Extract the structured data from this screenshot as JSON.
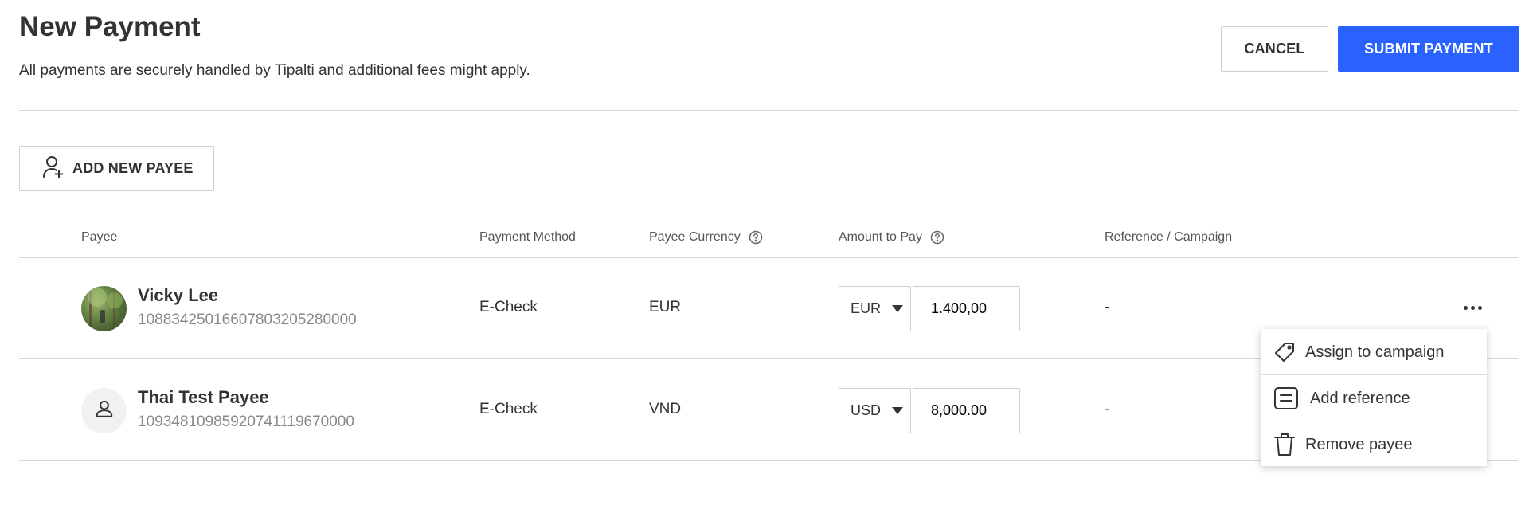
{
  "header": {
    "title": "New Payment",
    "subtitle": "All payments are securely handled by Tipalti and additional fees might apply.",
    "cancel_label": "CANCEL",
    "submit_label": "SUBMIT PAYMENT"
  },
  "add_payee_label": "ADD NEW PAYEE",
  "table": {
    "columns": {
      "payee": "Payee",
      "payment_method": "Payment Method",
      "payee_currency": "Payee Currency",
      "amount_to_pay": "Amount to Pay",
      "reference": "Reference / Campaign"
    },
    "rows": [
      {
        "name": "Vicky Lee",
        "id": "10883425016607803205280000",
        "method": "E-Check",
        "currency": "EUR",
        "amount_currency": "EUR",
        "amount": "1.400,00",
        "reference": "-"
      },
      {
        "name": "Thai Test Payee",
        "id": "10934810985920741119670000",
        "method": "E-Check",
        "currency": "VND",
        "amount_currency": "USD",
        "amount": "8,000.00",
        "reference": "-"
      }
    ]
  },
  "menu": {
    "items": [
      {
        "label": "Assign to campaign",
        "icon": "tag-icon"
      },
      {
        "label": "Add reference",
        "icon": "note-icon"
      },
      {
        "label": "Remove payee",
        "icon": "trash-icon"
      }
    ]
  },
  "colors": {
    "primary": "#2962ff",
    "border": "#cfcfcf",
    "text": "#333333",
    "muted": "#888888"
  }
}
